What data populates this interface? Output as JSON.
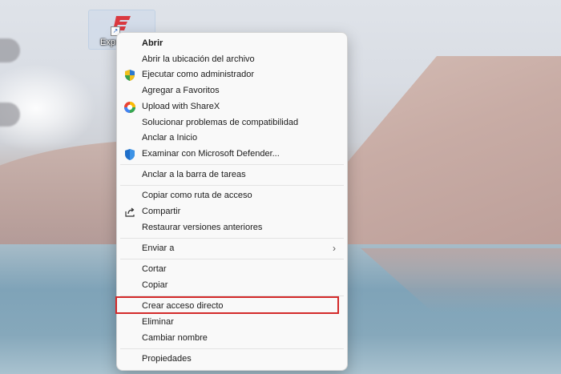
{
  "desktop_icon": {
    "label": "Expr",
    "icon": "expressvpn-logo",
    "brand_color": "#da3940"
  },
  "menu": {
    "items": [
      {
        "label": "Abrir",
        "icon": null,
        "bold": true
      },
      {
        "label": "Abrir la ubicación del archivo",
        "icon": null
      },
      {
        "label": "Ejecutar como administrador",
        "icon": "uac-shield-icon"
      },
      {
        "label": "Agregar a Favoritos",
        "icon": null
      },
      {
        "label": "Upload with ShareX",
        "icon": "sharex-icon"
      },
      {
        "label": "Solucionar problemas de compatibilidad",
        "icon": null
      },
      {
        "label": "Anclar a Inicio",
        "icon": null
      },
      {
        "label": "Examinar con Microsoft Defender...",
        "icon": "defender-shield-icon"
      },
      {
        "label": "Anclar a la barra de tareas",
        "icon": null
      },
      {
        "label": "Copiar como ruta de acceso",
        "icon": null
      },
      {
        "label": "Compartir",
        "icon": "share-icon"
      },
      {
        "label": "Restaurar versiones anteriores",
        "icon": null
      },
      {
        "label": "Enviar a",
        "icon": null,
        "submenu": true
      },
      {
        "label": "Cortar",
        "icon": null
      },
      {
        "label": "Copiar",
        "icon": null
      },
      {
        "label": "Crear acceso directo",
        "icon": null,
        "highlighted": true
      },
      {
        "label": "Eliminar",
        "icon": null
      },
      {
        "label": "Cambiar nombre",
        "icon": null
      },
      {
        "label": "Propiedades",
        "icon": null
      }
    ],
    "submenu_indicator": "›",
    "highlight_color": "#d32a2a"
  }
}
